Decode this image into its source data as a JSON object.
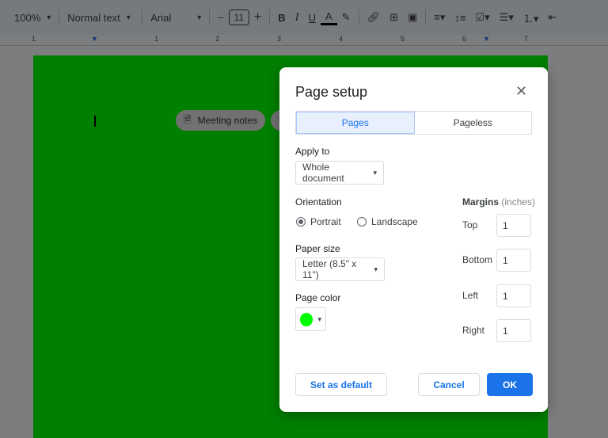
{
  "toolbar": {
    "zoom": "100%",
    "style": "Normal text",
    "font": "Arial",
    "font_size": "11",
    "minus": "−",
    "plus": "+",
    "bold": "B",
    "italic": "I",
    "underline": "U",
    "text_color": "A"
  },
  "ruler": {
    "ticks": [
      "1",
      "1",
      "2",
      "3",
      "4",
      "5",
      "6",
      "7"
    ]
  },
  "chips": {
    "meeting_notes": "Meeting notes"
  },
  "dialog": {
    "title": "Page setup",
    "close": "✕",
    "tabs": [
      "Pages",
      "Pageless"
    ],
    "apply_to_label": "Apply to",
    "apply_to_value": "Whole document",
    "orientation_label": "Orientation",
    "portrait": "Portrait",
    "landscape": "Landscape",
    "orientation_selected": "Portrait",
    "paper_size_label": "Paper size",
    "paper_size_value": "Letter (8.5\" x 11\")",
    "page_color_label": "Page color",
    "page_color": "#00ff00",
    "margins_label": "Margins",
    "margins_unit": "(inches)",
    "margins": [
      {
        "label": "Top",
        "value": "1"
      },
      {
        "label": "Bottom",
        "value": "1"
      },
      {
        "label": "Left",
        "value": "1"
      },
      {
        "label": "Right",
        "value": "1"
      }
    ],
    "set_default": "Set as default",
    "cancel": "Cancel",
    "ok": "OK"
  },
  "colors": {
    "accent": "#1a73e8"
  }
}
